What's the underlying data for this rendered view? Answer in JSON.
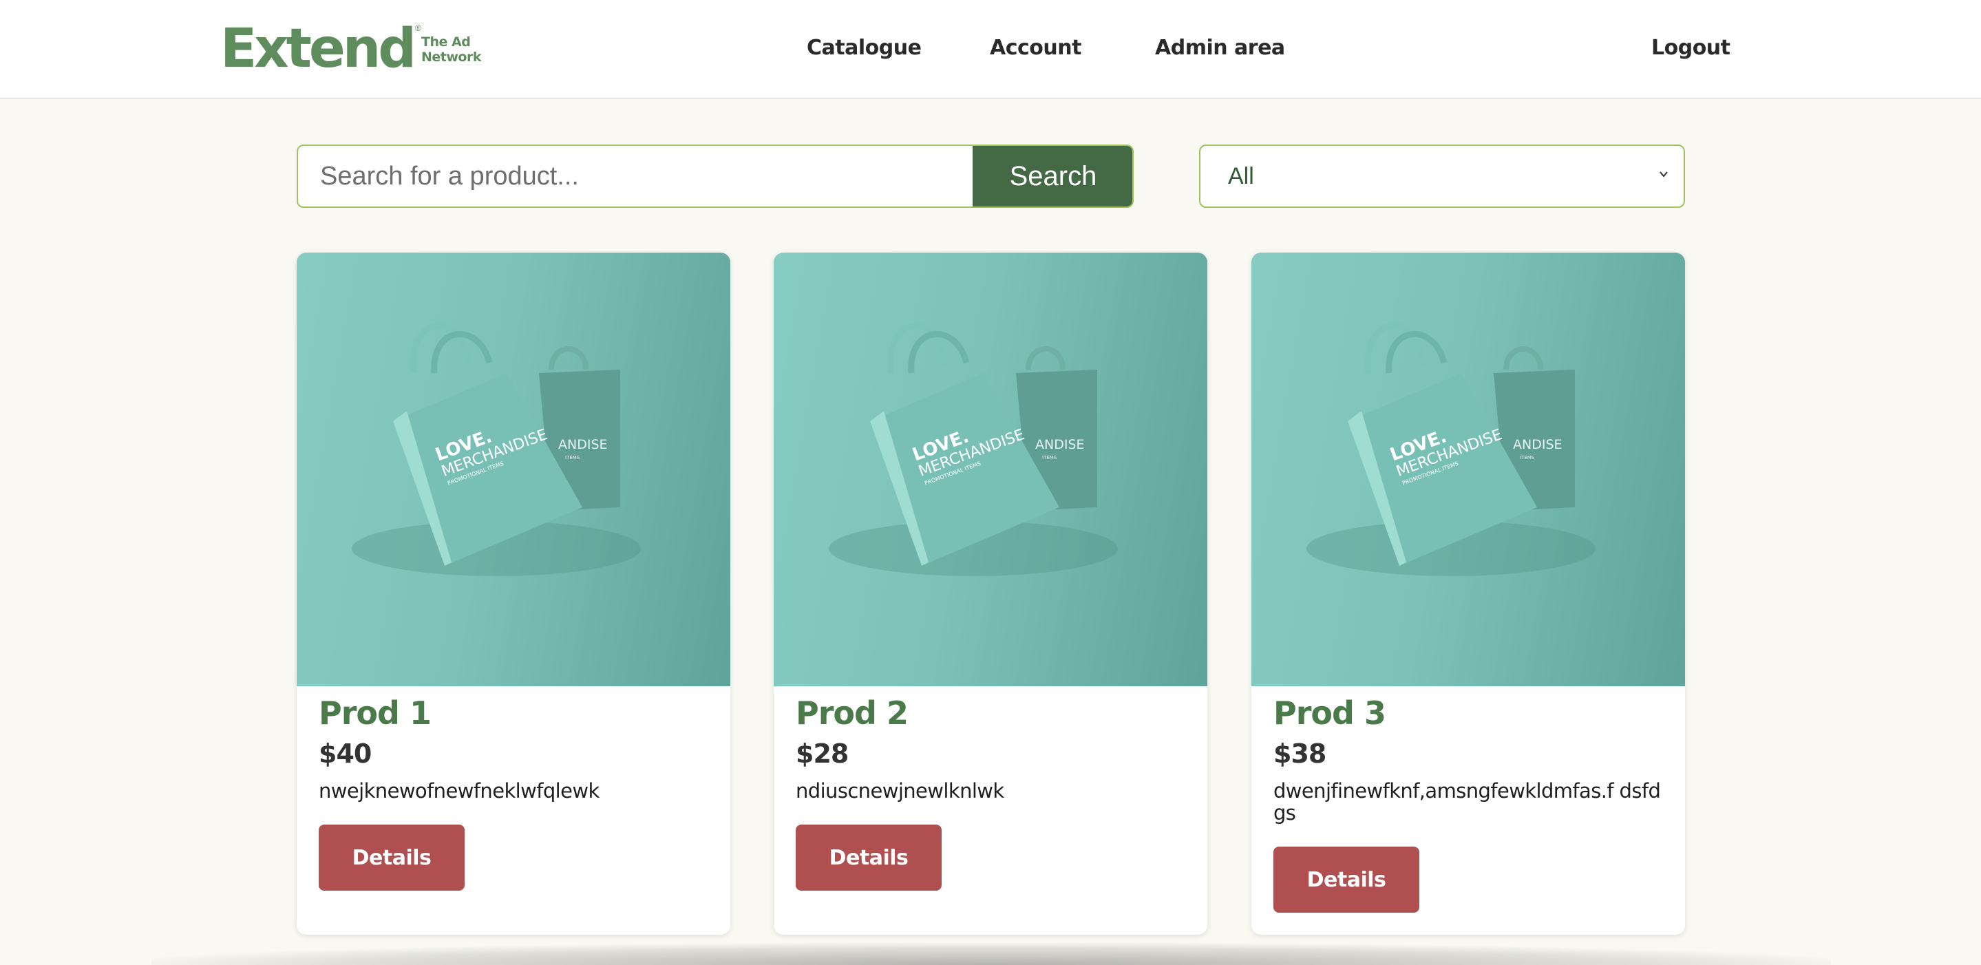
{
  "brand": {
    "name": "Extend",
    "tagline_line1": "The Ad",
    "tagline_line2": "Network",
    "color": "#5f8c5c"
  },
  "nav": {
    "items": [
      {
        "label": "Catalogue"
      },
      {
        "label": "Account"
      },
      {
        "label": "Admin area"
      }
    ],
    "logout_label": "Logout"
  },
  "search": {
    "placeholder": "Search for a product...",
    "value": "",
    "button_label": "Search"
  },
  "filter": {
    "selected": "All"
  },
  "products": [
    {
      "title": "Prod 1",
      "price": "$40",
      "description": "nwejknewofnewfneklwfqlewk",
      "details_label": "Details"
    },
    {
      "title": "Prod 2",
      "price": "$28",
      "description": "ndiuscnewjnewlknlwk",
      "details_label": "Details"
    },
    {
      "title": "Prod 3",
      "price": "$38",
      "description": "dwenjfinewfknf,amsngfewkldmfas.f dsfdgs",
      "details_label": "Details"
    }
  ],
  "product_image": {
    "bag_text_line1": "LOVE.",
    "bag_text_line2": "MERCHANDISE",
    "bag_text_line3": "PROMOTIONAL ITEMS",
    "back_bag_text": "ANDISE",
    "back_bag_small": "ITEMS"
  },
  "colors": {
    "accent_green": "#436a44",
    "button_red": "#b04f4f",
    "input_border": "#9fc25a",
    "page_bg": "#f9f8f2"
  }
}
